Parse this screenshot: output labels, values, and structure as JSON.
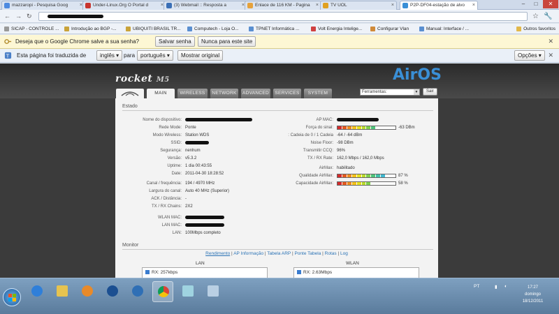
{
  "browser": {
    "tabs": [
      {
        "label": "mazzaropi - Pesquisa Goog",
        "color": "#4d8ae0"
      },
      {
        "label": "Under-Linux.Org O Portal d",
        "color": "#c8352e"
      },
      {
        "label": "(3) Webmail :: Resposta a",
        "color": "#3a6fb6"
      },
      {
        "label": "Enlace de 116 KM - Pagina",
        "color": "#e6a23c"
      },
      {
        "label": "TV UOL",
        "color": "#e0a020"
      },
      {
        "label": "P2P-DF04-estação de alvo",
        "color": "#3a8fd6"
      }
    ],
    "active_tab": 5,
    "window_controls": {
      "minimize": "–",
      "maximize": "□",
      "close": "✕"
    },
    "nav": {
      "back": "←",
      "forward": "→",
      "reload": "↻"
    },
    "url": "",
    "bookmarks": [
      {
        "label": "SICAP - CONTROLE ...",
        "color": "#999"
      },
      {
        "label": "Introdução ao BGP -...",
        "color": "#c9a33a"
      },
      {
        "label": "UBIQUITI BRASIL TR...",
        "color": "#c9a33a"
      },
      {
        "label": "Computech - Loja O...",
        "color": "#5a8fd0"
      },
      {
        "label": "TPNET Informática ...",
        "color": "#5a8fd0"
      },
      {
        "label": "Volt Energia Intelige...",
        "color": "#d04040"
      },
      {
        "label": "Configurar Vlan",
        "color": "#d08a3a"
      },
      {
        "label": "Manual: Interface / ...",
        "color": "#5a8fd0"
      }
    ],
    "other_bookmarks": "Outros favoritos"
  },
  "save_password_bar": {
    "question": "Deseja que o Google Chrome salve a sua senha?",
    "save": "Salvar senha",
    "never": "Nunca para este site"
  },
  "translate_bar": {
    "prefix": "Esta página foi traduzida de",
    "from_lang": "inglês",
    "middle": "para",
    "to_lang": "português",
    "show_original": "Mostrar original",
    "options": "Opções"
  },
  "airos": {
    "product": "rocket",
    "model": "M5",
    "brand": "AirOS",
    "tabs": [
      "MAIN",
      "WIRELESS",
      "NETWORK",
      "ADVANCED",
      "SERVICES",
      "SYSTEM"
    ],
    "active_tab": "MAIN",
    "tools_select": "Ferramentas:",
    "tools_button": "Sair",
    "status_title": "Estado",
    "left_fields": [
      {
        "label": "Nome do dispositivo:",
        "value": "",
        "redacted": true
      },
      {
        "label": "Rede Mode:",
        "value": "Ponte"
      },
      {
        "label": "Modo Wireless:",
        "value": "Station WDS"
      },
      {
        "label": "SSID:",
        "value": "",
        "redacted": true
      },
      {
        "label": "Segurança:",
        "value": "nenhum"
      },
      {
        "label": "Versão:",
        "value": "v5.3.2"
      },
      {
        "label": "Uptime:",
        "value": "1 dia 00:43:55"
      },
      {
        "label": "Date:",
        "value": "2011-04-30 18:28:52"
      },
      {
        "label": "Canal / frequência:",
        "value": "194 / 4970 MHz"
      },
      {
        "label": "Largura do canal:",
        "value": "Auto 40 MHz (Superior)"
      },
      {
        "label": "ACK / Distância:",
        "value": "-"
      },
      {
        "label": "TX / RX Chains:",
        "value": "2X2"
      },
      {
        "label": "WLAN MAC:",
        "value": "",
        "redacted": true
      },
      {
        "label": "LAN MAC:",
        "value": "",
        "redacted": true
      },
      {
        "label": "LAN:",
        "value": "100Mbps completo"
      }
    ],
    "right_fields": [
      {
        "label": "AP MAC:",
        "value": "",
        "redacted": true
      },
      {
        "label": "Força do sinal:",
        "value": "-63 DBm",
        "bar": true,
        "level": 0.7
      },
      {
        "label": ": Cadeia de 0 / 1 Cadeia",
        "value": "-64 / -64 dBm"
      },
      {
        "label": "Noise Floor:",
        "value": "-98 DBm"
      },
      {
        "label": "Transmitir CCQ:",
        "value": "96%"
      },
      {
        "label": "TX / RX Rate:",
        "value": "162,0 Mbps / 162,0 Mbps"
      },
      {
        "label": "AirMax:",
        "value": "habilitado"
      },
      {
        "label": "Qualidade AirMax:",
        "value": "87 %",
        "bar": true,
        "level": 0.87
      },
      {
        "label": "Capacidade AirMax:",
        "value": "58 %",
        "bar": true,
        "level": 0.58
      }
    ],
    "monitor_title": "Monitor",
    "monitor_links": [
      "Rendimento",
      "AP Informação",
      "Tabela ARP",
      "Ponte Tabela",
      "Rotas",
      "Log"
    ],
    "graphs": [
      {
        "title": "LAN",
        "legend": "RX: 257kbps"
      },
      {
        "title": "WLAN",
        "legend": "RX: 2.63Mbps"
      }
    ]
  },
  "taskbar": {
    "apps": [
      "ie",
      "explorer",
      "media",
      "hp",
      "chrome-alt",
      "chrome",
      "notepad",
      "tools"
    ],
    "active_app": 5,
    "lang": "PT",
    "time": "17:27",
    "day": "domingo",
    "date": "18/12/2011"
  }
}
